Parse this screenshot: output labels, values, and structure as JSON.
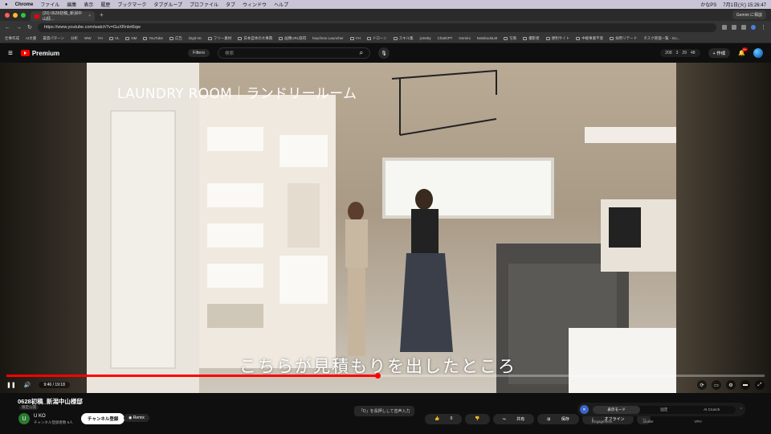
{
  "menubar": {
    "app": "Chrome",
    "items": [
      "ファイル",
      "編集",
      "表示",
      "履歴",
      "ブックマーク",
      "タブグループ",
      "プロファイル",
      "タブ",
      "ウィンドウ",
      "ヘルプ"
    ],
    "right": [
      "かなPS",
      "7月1日(火) 15:26:47"
    ]
  },
  "tab": {
    "title": "(20) 0628初稿_新潟中山邸…",
    "close": "×"
  },
  "newtab": "+",
  "gemini_btn": "Gemini に相談",
  "address": {
    "url": "https://www.youtube.com/watch?v=GuXRnlet6qw"
  },
  "bookmarks": [
    "仕事作成",
    "AI文書",
    "賃貸パターン",
    "分析",
    "WW",
    "YH",
    "VL",
    "NM",
    "YouTube",
    "広告",
    "Digit-Ve",
    "フリー素材",
    "日本自体の大事典",
    "画像URL取得",
    "keychron Launcher",
    "YH",
    "ドローン",
    "スキル集",
    "jUnetty",
    "ChatGPT",
    "Gemini",
    "NotebookLM",
    "写真",
    "撮影者",
    "便利サイト",
    "中継事業不意",
    "採用リテード",
    "タスク管理一覧 - Go..."
  ],
  "header": {
    "logo": "Premium",
    "filters": "Filters",
    "search_placeholder": "検索",
    "stats": [
      "208",
      "3",
      "29",
      "48"
    ],
    "create": "+ 作成",
    "badge": "9+"
  },
  "video": {
    "title_overlay": "LAUNDRY ROOM｜ランドリールーム",
    "subtitle": "こちらが見積もりを出したところ",
    "progress": 0.49,
    "time": "9:46 / 19:18"
  },
  "info": {
    "title": "0628初稿_新潟中山様邸",
    "visibility": "限定公開",
    "channel_initial": "U",
    "channel": "U KO",
    "subs": "チャンネル登録者数 6人",
    "subscribe": "チャンネル登録",
    "remix": "Remix",
    "hint": "「D」を長押しして音声入力",
    "actions": [
      "0",
      "",
      "共有",
      "保存",
      "オフライン",
      "…"
    ]
  },
  "panel": {
    "modes": [
      "表示モード",
      "固定",
      "AI Crunch"
    ],
    "labels": [
      "Engagement",
      "Outlier",
      "VPH"
    ]
  }
}
